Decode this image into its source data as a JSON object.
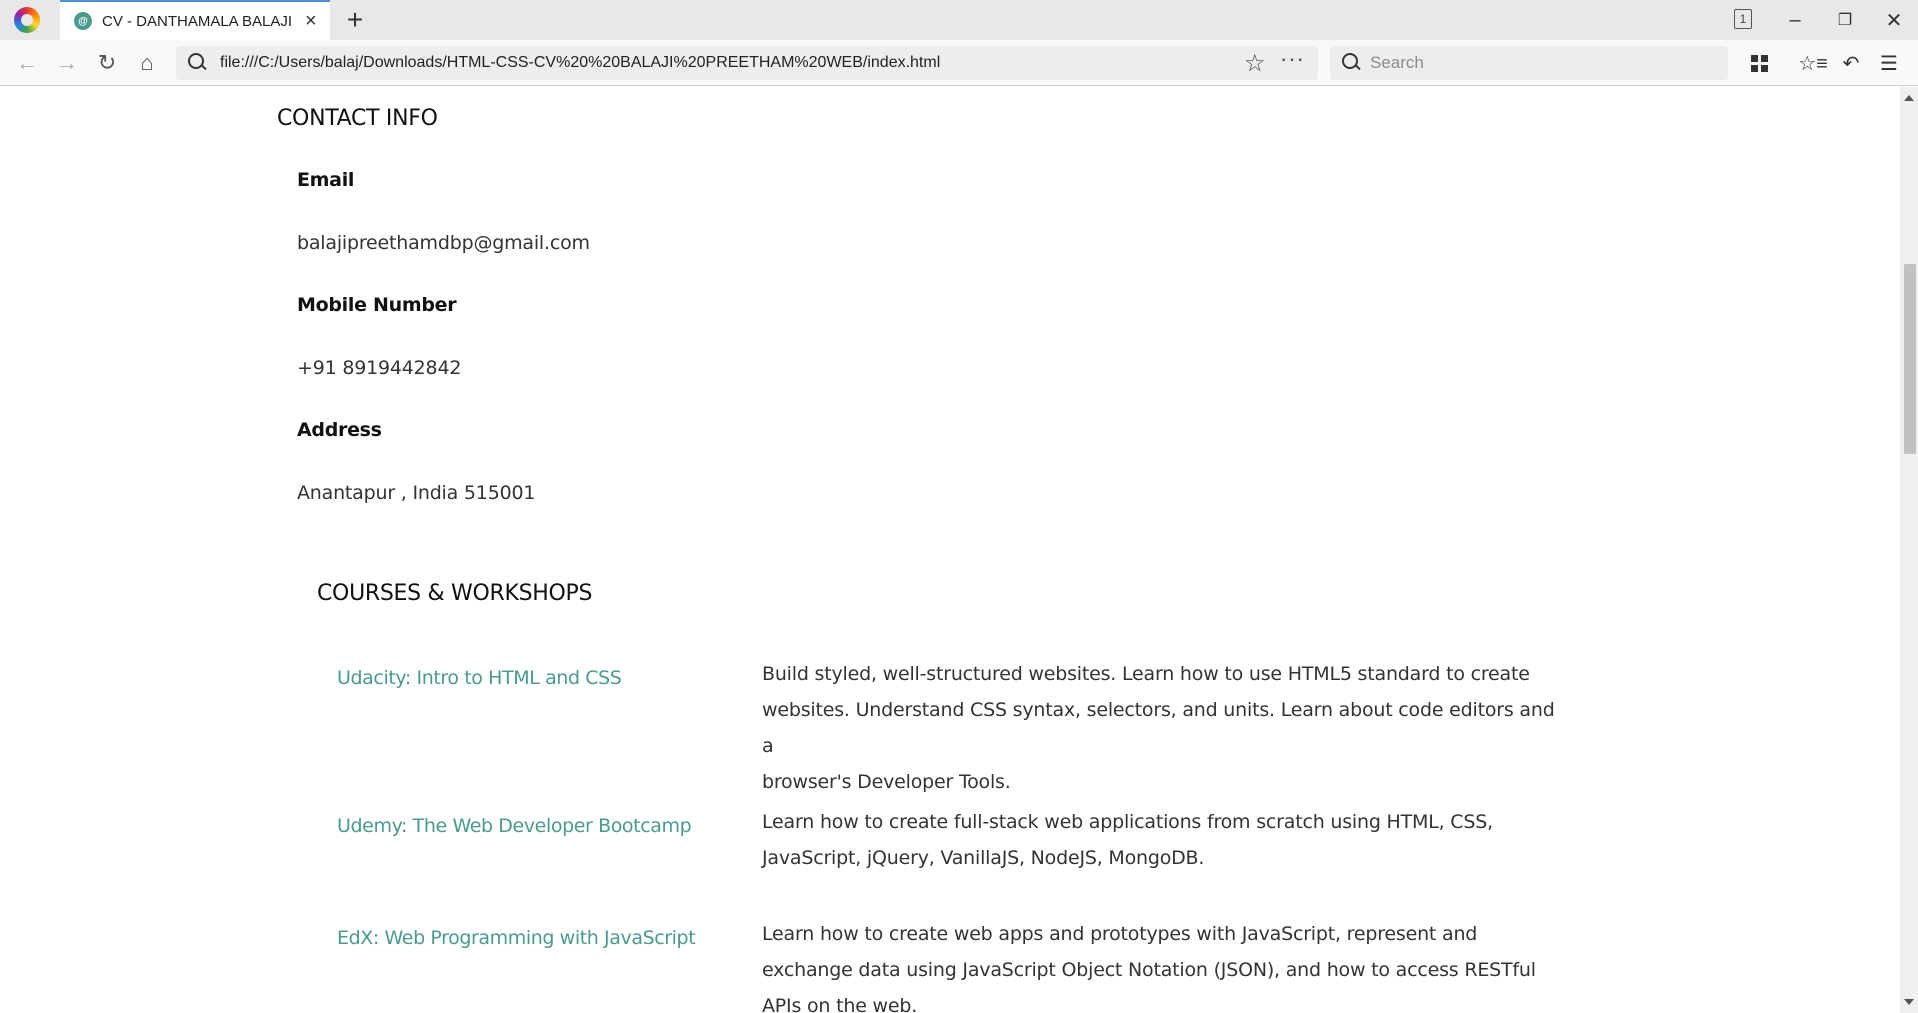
{
  "browser": {
    "tab_title": "CV - DANTHAMALA BALAJI PREETHAM",
    "tab_favicon_text": "@",
    "tab_count": "1",
    "url": "file:///C:/Users/balaj/Downloads/HTML-CSS-CV%20%20BALAJI%20PREETHAM%20WEB/index.html",
    "search_placeholder": "Search",
    "icons": {
      "back": "arrow-left-icon",
      "forward": "arrow-right-icon",
      "reload": "reload-icon",
      "home": "home-icon",
      "bookmark": "star-icon",
      "page_actions": "more-dots-icon",
      "library": "library-grid-icon",
      "bookmarks_menu": "bookmarks-icon",
      "undo": "undo-icon",
      "menu": "hamburger-icon"
    }
  },
  "contact": {
    "title": "CONTACT INFO",
    "email_label": "Email",
    "email_value": "balajipreethamdbp@gmail.com",
    "mobile_label": "Mobile Number",
    "mobile_value": "+91 8919442842",
    "address_label": "Address",
    "address_value": "Anantapur , India 515001"
  },
  "courses": {
    "title": "COURSES & WORKSHOPS",
    "items": [
      {
        "name": "Udacity: Intro to HTML and CSS",
        "desc_lines": [
          "Build styled, well-structured websites. Learn how to use HTML5 standard to create",
          "websites. Understand CSS syntax, selectors, and units. Learn about code editors and a",
          "browser's Developer Tools."
        ]
      },
      {
        "name": "Udemy: The Web Developer Bootcamp",
        "desc_lines": [
          "Learn how to create full-stack web applications from scratch using HTML, CSS,",
          "JavaScript, jQuery, VanillaJS, NodeJS, MongoDB."
        ]
      },
      {
        "name": "EdX: Web Programming with JavaScript",
        "desc_lines": [
          "Learn how to create web apps and prototypes with JavaScript, represent and",
          "exchange data using JavaScript Object Notation (JSON), and how to access RESTful",
          "APIs on the web."
        ]
      }
    ]
  },
  "colors": {
    "link_accent": "#4a9a8f",
    "tab_accent": "#4a90d9"
  }
}
